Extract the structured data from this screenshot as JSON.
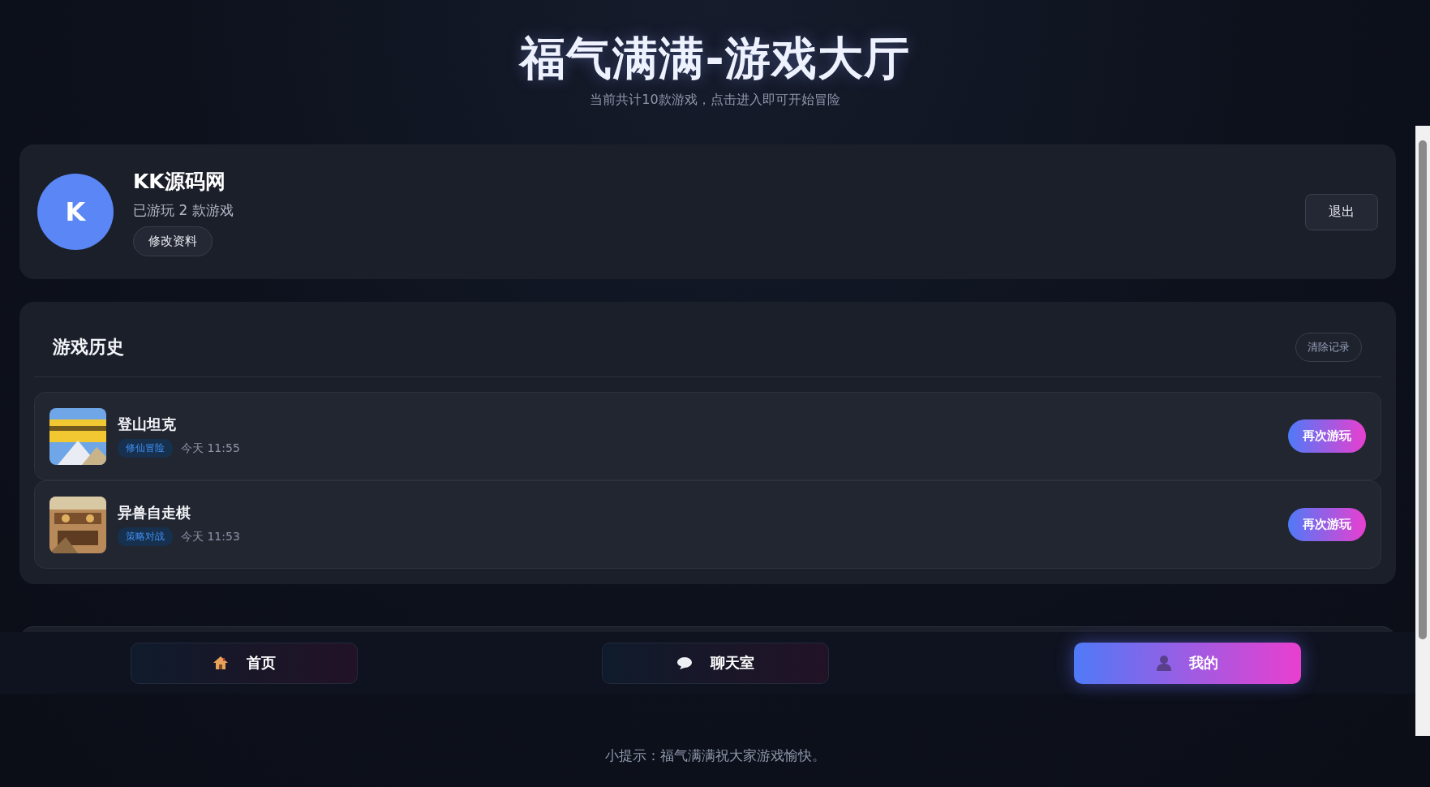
{
  "header": {
    "title": "福气满满-游戏大厅",
    "subtitle": "当前共计10款游戏，点击进入即可开始冒险"
  },
  "profile": {
    "avatar_letter": "K",
    "name": "KK源码网",
    "played": "已游玩 2 款游戏",
    "edit_button": "修改资料",
    "logout_button": "退出"
  },
  "history": {
    "title": "游戏历史",
    "clear_button": "清除记录",
    "items": [
      {
        "name": "登山坦克",
        "tag": "修仙冒险",
        "time": "今天 11:55",
        "button": "再次游玩"
      },
      {
        "name": "异兽自走棋",
        "tag": "策略对战",
        "time": "今天 11:53",
        "button": "再次游玩"
      }
    ]
  },
  "nav": [
    {
      "label": "首页",
      "kind": "home",
      "selected": false
    },
    {
      "label": "聊天室",
      "kind": "chat",
      "selected": false
    },
    {
      "label": "我的",
      "kind": "profile",
      "selected": true
    }
  ],
  "footer": "小提示：福气满满祝大家游戏愉快。"
}
